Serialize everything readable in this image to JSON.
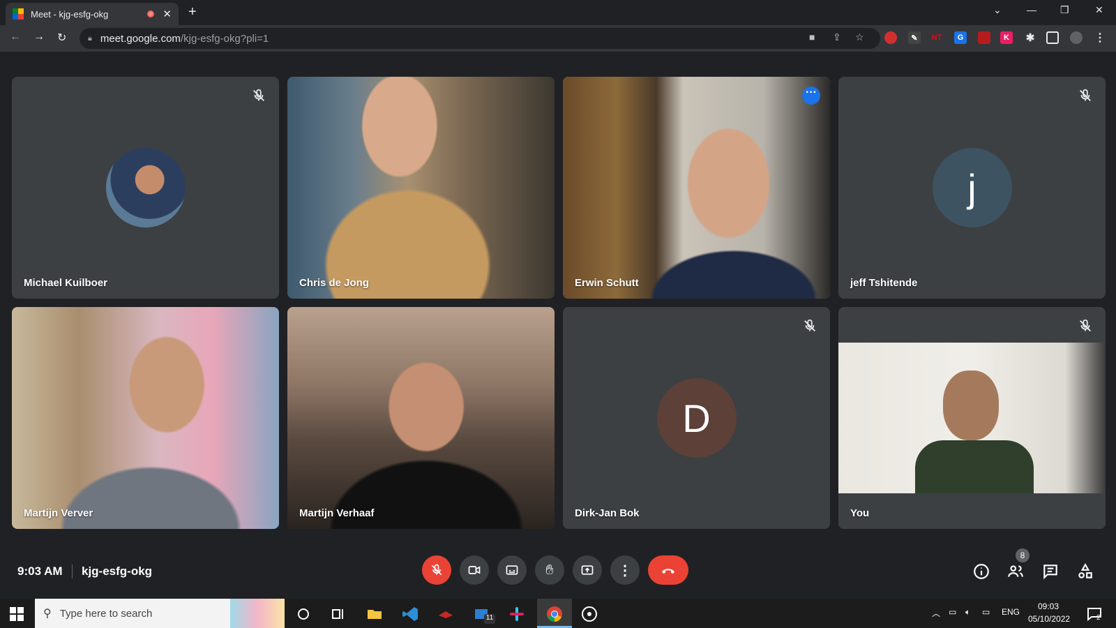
{
  "browser": {
    "tab_title": "Meet - kjg-esfg-okg",
    "url_host": "meet.google.com",
    "url_path": "/kjg-esfg-okg?pli=1"
  },
  "participants": [
    {
      "name": "Michael Kuilboer",
      "muted": true,
      "type": "photo-avatar"
    },
    {
      "name": "Chris de Jong",
      "muted": false,
      "type": "video"
    },
    {
      "name": "Erwin Schutt",
      "muted": false,
      "type": "video",
      "active_speaker": true
    },
    {
      "name": "jeff Tshitende",
      "muted": true,
      "type": "letter-avatar",
      "initial": "j",
      "avatar_color": "#3d5361"
    },
    {
      "name": "Martijn Verver",
      "muted": false,
      "type": "video"
    },
    {
      "name": "Martijn Verhaaf",
      "muted": false,
      "type": "video"
    },
    {
      "name": "Dirk-Jan Bok",
      "muted": true,
      "type": "letter-avatar",
      "initial": "D",
      "avatar_color": "#5d4037"
    },
    {
      "name": "You",
      "muted": true,
      "type": "video"
    }
  ],
  "meeting": {
    "time": "9:03 AM",
    "code": "kjg-esfg-okg",
    "people_count": "8"
  },
  "controls": {
    "mic_state": "muted",
    "leave_color": "#ea4335"
  },
  "taskbar": {
    "search_placeholder": "Type here to search",
    "mail_badge": "11",
    "lang": "ENG",
    "clock_time": "09:03",
    "clock_date": "05/10/2022",
    "notif_count": "2"
  }
}
